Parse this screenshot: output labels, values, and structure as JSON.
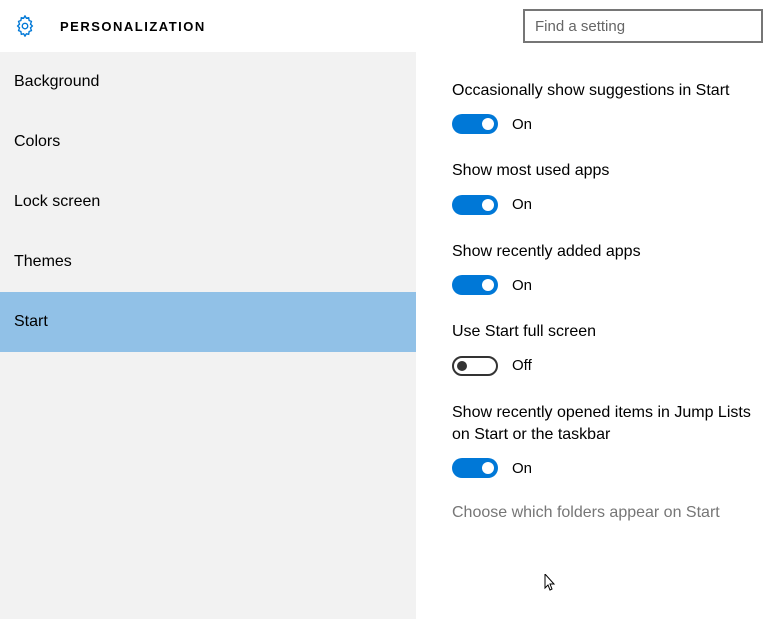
{
  "header": {
    "title": "PERSONALIZATION",
    "search_placeholder": "Find a setting"
  },
  "sidebar": {
    "items": [
      {
        "label": "Background",
        "selected": false
      },
      {
        "label": "Colors",
        "selected": false
      },
      {
        "label": "Lock screen",
        "selected": false
      },
      {
        "label": "Themes",
        "selected": false
      },
      {
        "label": "Start",
        "selected": true
      }
    ]
  },
  "main": {
    "settings": [
      {
        "label": "Occasionally show suggestions in Start",
        "on": true,
        "state_text": "On"
      },
      {
        "label": "Show most used apps",
        "on": true,
        "state_text": "On"
      },
      {
        "label": "Show recently added apps",
        "on": true,
        "state_text": "On"
      },
      {
        "label": "Use Start full screen",
        "on": false,
        "state_text": "Off"
      },
      {
        "label": "Show recently opened items in Jump Lists on Start or the taskbar",
        "on": true,
        "state_text": "On"
      }
    ],
    "link": "Choose which folders appear on Start"
  }
}
